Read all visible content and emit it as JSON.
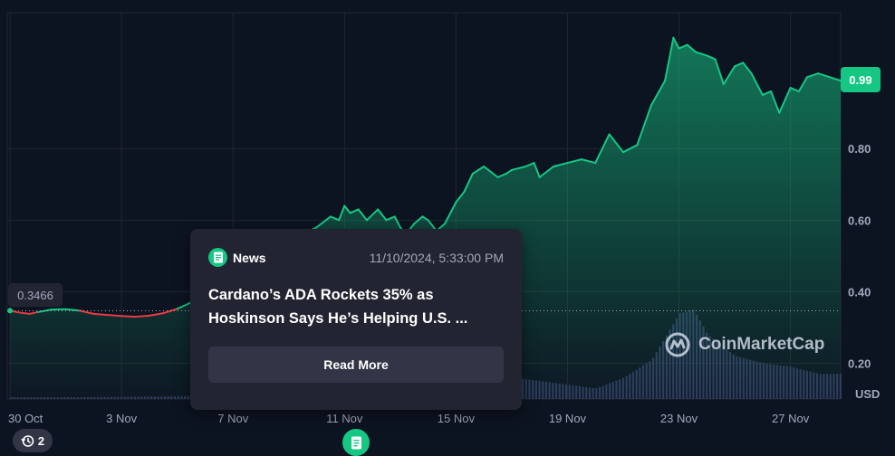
{
  "chart_data": {
    "type": "area",
    "ylabel": "USD",
    "ylim": [
      0.1,
      1.18
    ],
    "y_ticks": [
      "0.20",
      "0.40",
      "0.60",
      "0.80"
    ],
    "x_ticks": [
      "30 Oct",
      "3 Nov",
      "7 Nov",
      "11 Nov",
      "15 Nov",
      "19 Nov",
      "23 Nov",
      "27 Nov"
    ],
    "x_tick_day": [
      0,
      4,
      8,
      12,
      16,
      20,
      24,
      28
    ],
    "x_range_days": [
      -0.1,
      29.8
    ],
    "open_price": 0.3466,
    "open_label": "0.3466",
    "last_price": 0.99,
    "last_label": "0.99",
    "series": [
      {
        "x": [
          0,
          0.3,
          0.7,
          1.0,
          1.5,
          2.0,
          2.5,
          3.0,
          3.5,
          4.0,
          4.5,
          5.0,
          5.5,
          6.0,
          6.5,
          7.0,
          7.5,
          8.0,
          8.5,
          9.0,
          9.5,
          10.0,
          10.5,
          11.0,
          11.5,
          11.8,
          12.0,
          12.2,
          12.5,
          12.8,
          13.2,
          13.5,
          13.8,
          14.0,
          14.2,
          14.5,
          14.8,
          15.0,
          15.3,
          15.6,
          16.0,
          16.3,
          16.6,
          17.0,
          17.5,
          17.8,
          18.0,
          18.5,
          18.8,
          19.0,
          19.5,
          20.0,
          20.5,
          21.0,
          21.5,
          22.0,
          22.5,
          23.0,
          23.5,
          23.8,
          24.0,
          24.3,
          24.6,
          25.0,
          25.3,
          25.6,
          26.0,
          26.3,
          26.6,
          27.0,
          27.3,
          27.6,
          28.0,
          28.3,
          28.6,
          29.0,
          29.4,
          29.8
        ],
        "y": [
          0.347,
          0.342,
          0.338,
          0.343,
          0.35,
          0.351,
          0.347,
          0.338,
          0.335,
          0.332,
          0.33,
          0.333,
          0.34,
          0.352,
          0.37,
          0.39,
          0.42,
          0.45,
          0.47,
          0.49,
          0.51,
          0.53,
          0.56,
          0.58,
          0.61,
          0.6,
          0.64,
          0.62,
          0.63,
          0.6,
          0.63,
          0.6,
          0.61,
          0.58,
          0.56,
          0.59,
          0.61,
          0.6,
          0.57,
          0.59,
          0.65,
          0.68,
          0.73,
          0.75,
          0.72,
          0.73,
          0.74,
          0.75,
          0.76,
          0.72,
          0.75,
          0.76,
          0.77,
          0.76,
          0.84,
          0.79,
          0.81,
          0.92,
          0.99,
          1.11,
          1.08,
          1.09,
          1.07,
          1.06,
          1.05,
          0.98,
          1.03,
          1.04,
          1.01,
          0.95,
          0.96,
          0.9,
          0.97,
          0.96,
          1.0,
          1.01,
          1.0,
          0.99
        ]
      }
    ],
    "volume": {
      "x": [
        0,
        2,
        4,
        6,
        8,
        9,
        10,
        11,
        12,
        13,
        14,
        15,
        16,
        17,
        18,
        19,
        20,
        21,
        22,
        23,
        24,
        24.5,
        25,
        26,
        27,
        28,
        29,
        29.8
      ],
      "v": [
        0.005,
        0.005,
        0.006,
        0.008,
        0.012,
        0.02,
        0.04,
        0.09,
        0.15,
        0.18,
        0.12,
        0.11,
        0.1,
        0.08,
        0.06,
        0.05,
        0.04,
        0.03,
        0.06,
        0.11,
        0.24,
        0.25,
        0.18,
        0.12,
        0.1,
        0.09,
        0.07,
        0.07
      ]
    }
  },
  "watermark": "CoinMarketCap",
  "news": {
    "label": "News",
    "date": "11/10/2024, 5:33:00 PM",
    "title": "Cardano’s ADA Rockets 35% as Hoskinson Says He’s Helping U.S. ...",
    "button": "Read More"
  },
  "history": {
    "count": "2"
  },
  "colors": {
    "up": "#16c784",
    "down": "#ea3943",
    "bg": "#0d1421",
    "grid": "#222531",
    "volume": "#3a4470"
  }
}
